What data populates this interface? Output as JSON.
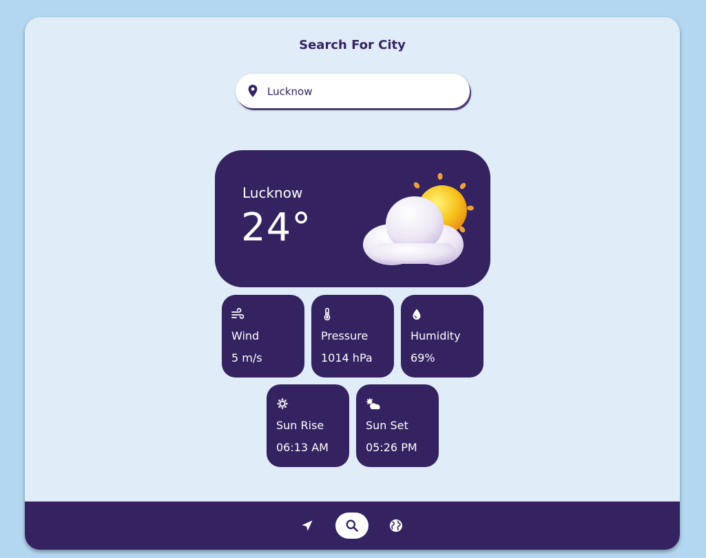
{
  "header": {
    "title": "Search For City"
  },
  "search": {
    "value": "Lucknow",
    "placeholder": ""
  },
  "current": {
    "city": "Lucknow",
    "temperature": "24°",
    "condition_icon": "partly-cloudy-sun-icon"
  },
  "details": [
    {
      "key": "wind",
      "icon": "wind-icon",
      "label": "Wind",
      "value": "5 m/s"
    },
    {
      "key": "pressure",
      "icon": "thermometer-icon",
      "label": "Pressure",
      "value": "1014 hPa"
    },
    {
      "key": "humidity",
      "icon": "droplet-icon",
      "label": "Humidity",
      "value": "69%"
    },
    {
      "key": "sunrise",
      "icon": "sun-icon",
      "label": "Sun Rise",
      "value": "06:13 AM"
    },
    {
      "key": "sunset",
      "icon": "sun-cloud-icon",
      "label": "Sun Set",
      "value": "05:26 PM"
    }
  ],
  "nav": [
    {
      "icon": "location-arrow-icon",
      "active": false
    },
    {
      "icon": "search-icon",
      "active": true
    },
    {
      "icon": "globe-icon",
      "active": false
    }
  ],
  "colors": {
    "page_background": "#b3d7f0",
    "panel_background": "#e0edf9",
    "primary": "#342261",
    "text_on_primary": "#ffffff"
  }
}
